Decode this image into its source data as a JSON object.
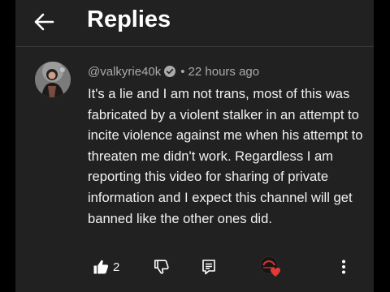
{
  "header": {
    "title": "Replies",
    "back_icon": "arrow-left-icon"
  },
  "comment": {
    "username": "@valkyrie40k",
    "verified_icon": "verified-check-icon",
    "separator": "•",
    "time": "22 hours ago",
    "text": "It's a lie and I am not trans, most of this was fabricated by a violent stalker in an attempt to incite violence against me when his attempt to threaten me didn't work. Regardless I am reporting this video for sharing of private information and I expect this channel will get banned like the other ones did."
  },
  "actions": {
    "like_icon": "thumbs-up-icon",
    "like_count": "2",
    "dislike_icon": "thumbs-down-icon",
    "reply_icon": "reply-comment-icon",
    "creator_heart_icon": "creator-heart-icon",
    "more_icon": "more-vertical-icon"
  },
  "colors": {
    "background": "#212121",
    "text": "#f1f1f1",
    "secondary_text": "#aaaaaa",
    "heart": "#e53935"
  }
}
